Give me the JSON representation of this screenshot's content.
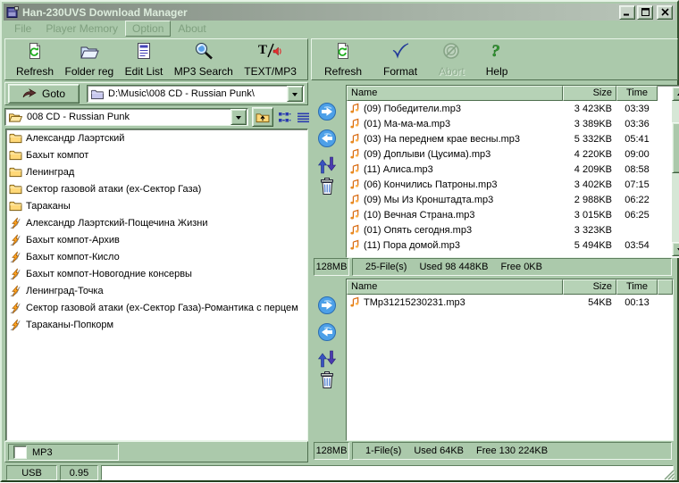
{
  "window": {
    "title": "Han-230UVS Download Manager"
  },
  "menu": {
    "items": [
      "File",
      "Player Memory",
      "Option",
      "About"
    ]
  },
  "toolbar_left": {
    "refresh": "Refresh",
    "folder_reg": "Folder reg",
    "edit_list": "Edit List",
    "mp3_search": "MP3 Search",
    "text_mp3": "TEXT/MP3"
  },
  "toolbar_right": {
    "refresh": "Refresh",
    "format": "Format",
    "abort": "Abort",
    "help": "Help"
  },
  "explorer": {
    "goto_label": "Goto",
    "path_value": "D:\\Music\\008 CD - Russian Punk\\",
    "folder_value": "008 CD - Russian Punk",
    "mp3_label": "MP3",
    "items": [
      {
        "type": "folder",
        "name": "Александр Лаэртский"
      },
      {
        "type": "folder",
        "name": "Бахыт компот"
      },
      {
        "type": "folder",
        "name": "Ленинград"
      },
      {
        "type": "folder",
        "name": "Сектор газовой атаки (ex-Сектор Газа)"
      },
      {
        "type": "folder",
        "name": "Тараканы"
      },
      {
        "type": "playlist",
        "name": "Александр Лаэртский-Пощечина Жизни"
      },
      {
        "type": "playlist",
        "name": "Бахыт компот-Архив"
      },
      {
        "type": "playlist",
        "name": "Бахыт компот-Кисло"
      },
      {
        "type": "playlist",
        "name": "Бахыт компот-Новогодние консервы"
      },
      {
        "type": "playlist",
        "name": "Ленинград-Точка"
      },
      {
        "type": "playlist",
        "name": "Сектор газовой атаки (ex-Сектор Газа)-Романтика с перцем"
      },
      {
        "type": "playlist",
        "name": "Тараканы-Попкорм"
      }
    ]
  },
  "device_top": {
    "columns": {
      "name": "Name",
      "size": "Size",
      "time": "Time"
    },
    "files": [
      {
        "name": "(09) Победители.mp3",
        "size": "3 423KB",
        "time": "03:39"
      },
      {
        "name": "(01) Ма-ма-ма.mp3",
        "size": "3 389KB",
        "time": "03:36"
      },
      {
        "name": "(03) На переднем крае весны.mp3",
        "size": "5 332KB",
        "time": "05:41"
      },
      {
        "name": "(09) Доплыви (Цусима).mp3",
        "size": "4 220KB",
        "time": "09:00"
      },
      {
        "name": "(11) Алиса.mp3",
        "size": "4 209KB",
        "time": "08:58"
      },
      {
        "name": "(06) Кончились Патроны.mp3",
        "size": "3 402KB",
        "time": "07:15"
      },
      {
        "name": "(09) Мы Из Кронштадта.mp3",
        "size": "2 988KB",
        "time": "06:22"
      },
      {
        "name": "(10) Вечная Страна.mp3",
        "size": "3 015KB",
        "time": "06:25"
      },
      {
        "name": "(01) Опять сегодня.mp3",
        "size": "3 323KB",
        "time": ""
      },
      {
        "name": "(11) Пора домой.mp3",
        "size": "5 494KB",
        "time": "03:54"
      }
    ],
    "memory": "128MB",
    "files_count": "25-File(s)",
    "used": "Used 98 448KB",
    "free": "Free 0KB"
  },
  "device_bottom": {
    "columns": {
      "name": "Name",
      "size": "Size",
      "time": "Time"
    },
    "files": [
      {
        "name": "TMp31215230231.mp3",
        "size": "54KB",
        "time": "00:13"
      }
    ],
    "memory": "128MB",
    "files_count": "1-File(s)",
    "used": "Used 64KB",
    "free": "Free 130 224KB"
  },
  "statusbar": {
    "device": "USB",
    "version": "0.95",
    "message": ""
  },
  "colors": {
    "window_bg": "#abc9ab",
    "titlebar_left": "#7f897f",
    "titlebar_right": "#bac6ba",
    "list_bg": "#ffffff",
    "header_bg": "#b6d2b6",
    "disabled_text": "#8fac8f",
    "accent_blue": "#3355cc",
    "folder_yellow": "#ffd878",
    "note_orange": "#e07818"
  }
}
